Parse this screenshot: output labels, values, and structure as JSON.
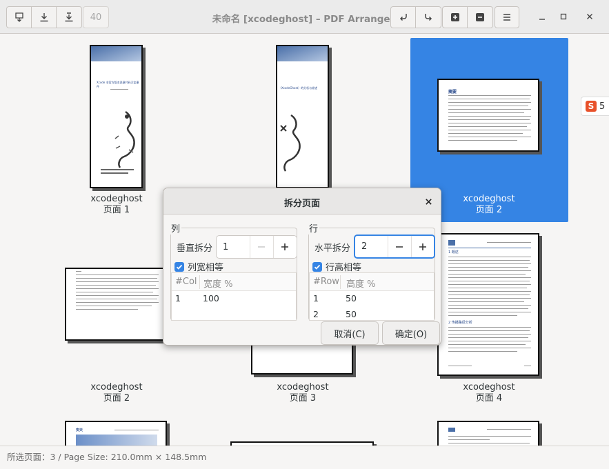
{
  "window": {
    "title": "未命名 [xcodeghost] – PDF Arranger",
    "zoom_value": "40"
  },
  "content": {
    "pages": [
      {
        "name": "xcodeghost",
        "page_label": "页面 1",
        "selected": false
      },
      {
        "name": "xcodeghost",
        "page_label": "页面 2",
        "selected": true
      },
      {
        "name": "xcodeghost",
        "page_label": "页面 2",
        "selected": false
      },
      {
        "name": "xcodeghost",
        "page_label": "页面 3",
        "selected": false
      },
      {
        "name": "xcodeghost",
        "page_label": "页面 4",
        "selected": false
      }
    ],
    "thumb_text": {
      "p1_title": "Xcode 非官方版本恶意代码污染事件",
      "p1_sub": "（XcodeGhost）的分析与综述",
      "abstract_heading": "摘要",
      "p4_heading": "1 概述",
      "p4_heading2": "2 传播路径分析",
      "p5_brand": "安天"
    }
  },
  "side_widget": {
    "icon_text": "S",
    "text": "5"
  },
  "statusbar": {
    "text": "所选页面：3 / Page Size: 210.0mm × 148.5mm"
  },
  "dialog": {
    "title": "拆分页面",
    "columns": {
      "frame_label": "列",
      "split_label": "垂直拆分",
      "split_value": "1",
      "equal_label": "列宽相等",
      "col_header_num": "#Col",
      "col_header_val": "宽度 %",
      "rows": [
        {
          "num": "1",
          "val": "100"
        }
      ]
    },
    "rows": {
      "frame_label": "行",
      "split_label": "水平拆分",
      "split_value": "2",
      "equal_label": "行高相等",
      "col_header_num": "#Row",
      "col_header_val": "高度 %",
      "rows": [
        {
          "num": "1",
          "val": "50"
        },
        {
          "num": "2",
          "val": "50"
        }
      ]
    },
    "cancel_label": "取消(C)",
    "ok_label": "确定(O)"
  }
}
